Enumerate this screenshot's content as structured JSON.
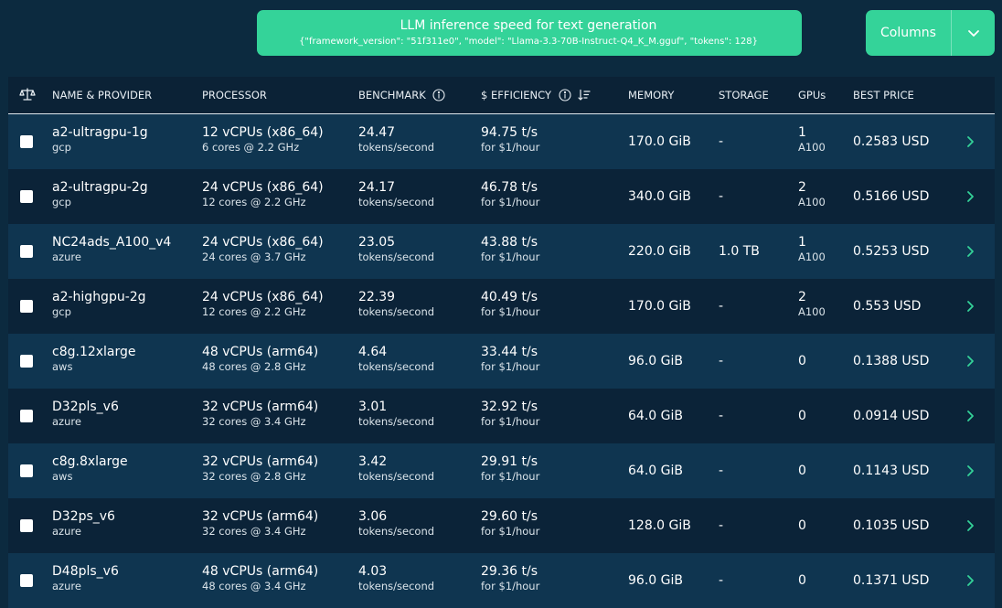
{
  "benchmark": {
    "title": "LLM inference speed for text generation",
    "params": "{\"framework_version\": \"51f311e0\", \"model\": \"Llama-3.3-70B-Instruct-Q4_K_M.gguf\", \"tokens\": 128}",
    "icon": "gauge-icon"
  },
  "columns_button": {
    "label": "Columns",
    "icon": "chevron-down-icon"
  },
  "table": {
    "headers": {
      "compare_icon": "scale-icon",
      "name": "NAME & PROVIDER",
      "processor": "PROCESSOR",
      "benchmark": "BENCHMARK",
      "efficiency": "$ EFFICIENCY",
      "memory": "MEMORY",
      "storage": "STORAGE",
      "gpus": "GPUs",
      "price": "BEST PRICE"
    },
    "rows": [
      {
        "name": "a2-ultragpu-1g",
        "provider": "gcp",
        "vcpus": "12 vCPUs (x86_64)",
        "cores": "6 cores @ 2.2 GHz",
        "bench": "24.47",
        "bench_unit": "tokens/second",
        "eff": "94.75 t/s",
        "eff_unit": "for $1/hour",
        "memory": "170.0 GiB",
        "storage": "-",
        "gpus": "1",
        "gpu_model": "A100",
        "price": "0.2583 USD"
      },
      {
        "name": "a2-ultragpu-2g",
        "provider": "gcp",
        "vcpus": "24 vCPUs (x86_64)",
        "cores": "12 cores @ 2.2 GHz",
        "bench": "24.17",
        "bench_unit": "tokens/second",
        "eff": "46.78 t/s",
        "eff_unit": "for $1/hour",
        "memory": "340.0 GiB",
        "storage": "-",
        "gpus": "2",
        "gpu_model": "A100",
        "price": "0.5166 USD"
      },
      {
        "name": "NC24ads_A100_v4",
        "provider": "azure",
        "vcpus": "24 vCPUs (x86_64)",
        "cores": "24 cores @ 3.7 GHz",
        "bench": "23.05",
        "bench_unit": "tokens/second",
        "eff": "43.88 t/s",
        "eff_unit": "for $1/hour",
        "memory": "220.0 GiB",
        "storage": "1.0 TB",
        "gpus": "1",
        "gpu_model": "A100",
        "price": "0.5253 USD"
      },
      {
        "name": "a2-highgpu-2g",
        "provider": "gcp",
        "vcpus": "24 vCPUs (x86_64)",
        "cores": "12 cores @ 2.2 GHz",
        "bench": "22.39",
        "bench_unit": "tokens/second",
        "eff": "40.49 t/s",
        "eff_unit": "for $1/hour",
        "memory": "170.0 GiB",
        "storage": "-",
        "gpus": "2",
        "gpu_model": "A100",
        "price": "0.553 USD"
      },
      {
        "name": "c8g.12xlarge",
        "provider": "aws",
        "vcpus": "48 vCPUs (arm64)",
        "cores": "48 cores @ 2.8 GHz",
        "bench": "4.64",
        "bench_unit": "tokens/second",
        "eff": "33.44 t/s",
        "eff_unit": "for $1/hour",
        "memory": "96.0 GiB",
        "storage": "-",
        "gpus": "0",
        "gpu_model": "",
        "price": "0.1388 USD"
      },
      {
        "name": "D32pls_v6",
        "provider": "azure",
        "vcpus": "32 vCPUs (arm64)",
        "cores": "32 cores @ 3.4 GHz",
        "bench": "3.01",
        "bench_unit": "tokens/second",
        "eff": "32.92 t/s",
        "eff_unit": "for $1/hour",
        "memory": "64.0 GiB",
        "storage": "-",
        "gpus": "0",
        "gpu_model": "",
        "price": "0.0914 USD"
      },
      {
        "name": "c8g.8xlarge",
        "provider": "aws",
        "vcpus": "32 vCPUs (arm64)",
        "cores": "32 cores @ 2.8 GHz",
        "bench": "3.42",
        "bench_unit": "tokens/second",
        "eff": "29.91 t/s",
        "eff_unit": "for $1/hour",
        "memory": "64.0 GiB",
        "storage": "-",
        "gpus": "0",
        "gpu_model": "",
        "price": "0.1143 USD"
      },
      {
        "name": "D32ps_v6",
        "provider": "azure",
        "vcpus": "32 vCPUs (arm64)",
        "cores": "32 cores @ 3.4 GHz",
        "bench": "3.06",
        "bench_unit": "tokens/second",
        "eff": "29.60 t/s",
        "eff_unit": "for $1/hour",
        "memory": "128.0 GiB",
        "storage": "-",
        "gpus": "0",
        "gpu_model": "",
        "price": "0.1035 USD"
      },
      {
        "name": "D48pls_v6",
        "provider": "azure",
        "vcpus": "48 vCPUs (arm64)",
        "cores": "48 cores @ 3.4 GHz",
        "bench": "4.03",
        "bench_unit": "tokens/second",
        "eff": "29.36 t/s",
        "eff_unit": "for $1/hour",
        "memory": "96.0 GiB",
        "storage": "-",
        "gpus": "0",
        "gpu_model": "",
        "price": "0.1371 USD"
      }
    ]
  },
  "colors": {
    "accent": "#34d399",
    "background": "#0c2a3f",
    "row_alt": "#0f3550"
  }
}
